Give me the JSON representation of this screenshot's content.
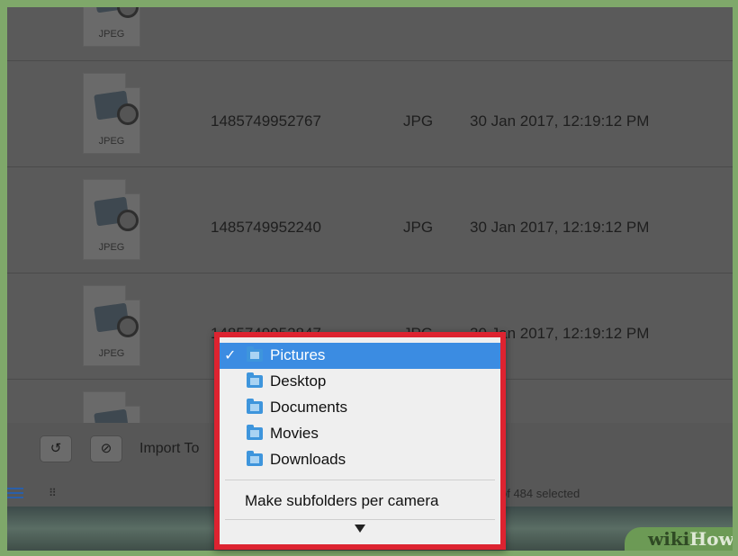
{
  "rows": [
    {
      "thumb_label": "JPEG",
      "name": "",
      "kind": "",
      "date": ""
    },
    {
      "thumb_label": "JPEG",
      "name": "1485749952767",
      "kind": "JPG",
      "date": "30 Jan 2017, 12:19:12 PM"
    },
    {
      "thumb_label": "JPEG",
      "name": "1485749952240",
      "kind": "JPG",
      "date": "30 Jan 2017, 12:19:12 PM"
    },
    {
      "thumb_label": "JPEG",
      "name": "1485749952847",
      "kind": "JPG",
      "date": "30 Jan 2017, 12:19:12 PM"
    }
  ],
  "toolbar": {
    "rotate_glyph": "↺",
    "delete_glyph": "⊘",
    "import_to_label": "Import To"
  },
  "status": {
    "grid_glyph": "⠿",
    "selected_text": "of 484 selected"
  },
  "menu": {
    "items": [
      {
        "label": "Pictures",
        "icon": "pictures-folder-icon",
        "checked": true
      },
      {
        "label": "Desktop",
        "icon": "desktop-folder-icon",
        "checked": false
      },
      {
        "label": "Documents",
        "icon": "documents-folder-icon",
        "checked": false
      },
      {
        "label": "Movies",
        "icon": "movies-folder-icon",
        "checked": false
      },
      {
        "label": "Downloads",
        "icon": "downloads-folder-icon",
        "checked": false
      }
    ],
    "check_glyph": "✓",
    "subfolders_label": "Make subfolders per camera",
    "highlight_color": "#3b8ce2",
    "annotation_color": "#dd2330"
  },
  "watermark": {
    "part1": "wiki",
    "part2": "How"
  }
}
